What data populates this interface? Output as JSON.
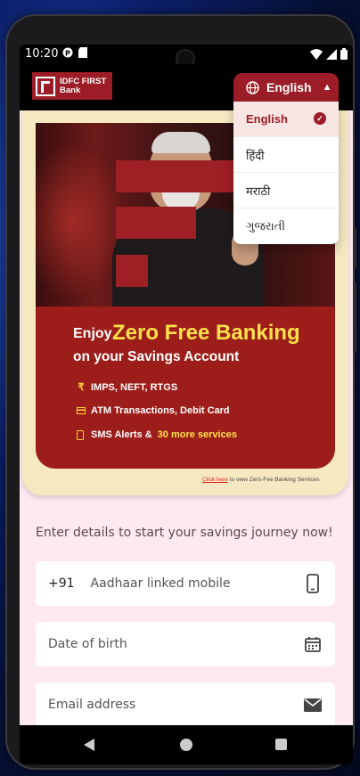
{
  "status_bar": {
    "time": "10:20"
  },
  "header": {
    "logo_text": "IDFC FIRST Bank",
    "logo_line1": "IDFC FIRST",
    "logo_line2": "Bank",
    "language_button": "English"
  },
  "language_menu": {
    "options": [
      {
        "label": "English",
        "selected": true
      },
      {
        "label": "हिंदी",
        "selected": false
      },
      {
        "label": "मराठी",
        "selected": false
      },
      {
        "label": "ગુજરાતી",
        "selected": false
      }
    ]
  },
  "hero": {
    "enjoy": "Enjoy",
    "headline": "Zero Free Banking",
    "subline": "on your Savings Account",
    "features": [
      {
        "icon": "rupee-icon",
        "text": "IMPS, NEFT, RTGS"
      },
      {
        "icon": "card-icon",
        "text": "ATM Transactions, Debit Card"
      },
      {
        "icon": "phone-icon",
        "text": "SMS Alerts &",
        "highlight": "30 more services"
      }
    ],
    "link_text": "Click here",
    "link_suffix": "to view Zero-Fee Banking Services"
  },
  "form": {
    "prompt": "Enter details to start your savings journey now!",
    "mobile": {
      "country_code": "+91",
      "placeholder": "Aadhaar linked mobile"
    },
    "dob": {
      "placeholder": "Date of birth"
    },
    "email": {
      "placeholder": "Email address"
    }
  },
  "colors": {
    "brand_red": "#9c1d27",
    "highlight_yellow": "#ffe14a",
    "page_bg": "#fde9ef",
    "card_bg": "#f6e9c2"
  }
}
